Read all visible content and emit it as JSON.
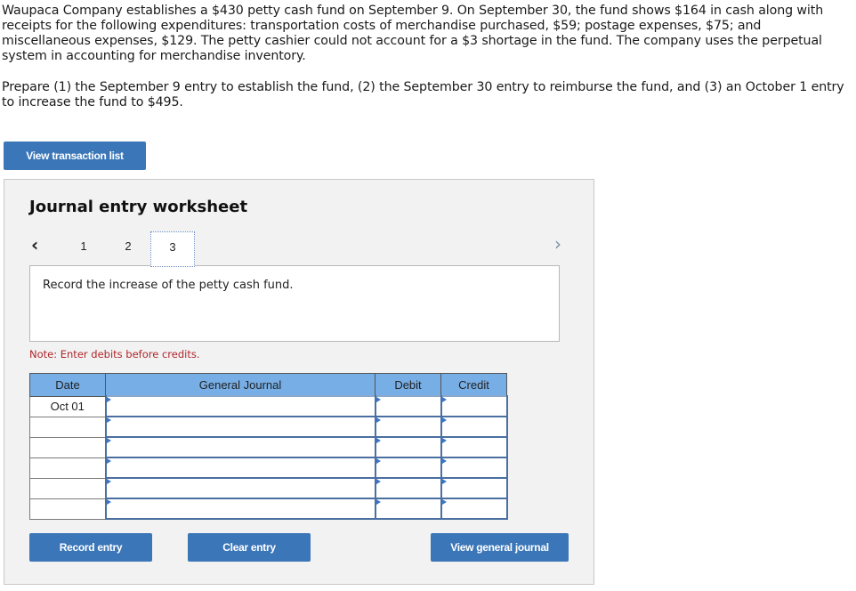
{
  "question": {
    "paragraph1": "Waupaca Company establishes a $430 petty cash fund on September 9. On September 30, the fund shows $164 in cash along with receipts for the following expenditures: transportation costs of merchandise purchased, $59; postage expenses, $75; and miscellaneous expenses, $129. The petty cashier could not account for a $3 shortage in the fund. The company uses the perpetual system in accounting for merchandise inventory.",
    "paragraph2": "Prepare (1) the September 9 entry to establish the fund, (2) the September 30 entry to reimburse the fund, and (3) an October 1 entry to increase the fund to $495."
  },
  "buttons": {
    "view_transaction_list": "View transaction list",
    "record_entry": "Record entry",
    "clear_entry": "Clear entry",
    "view_general_journal": "View general journal"
  },
  "worksheet": {
    "title": "Journal entry worksheet",
    "prev_icon": "‹",
    "next_icon": "›",
    "tabs": [
      {
        "label": "1",
        "active": false
      },
      {
        "label": "2",
        "active": false
      },
      {
        "label": "3",
        "active": true
      }
    ],
    "description": "Record the increase of the petty cash fund.",
    "note": "Note: Enter debits before credits."
  },
  "journal": {
    "headers": {
      "date": "Date",
      "general_journal": "General Journal",
      "debit": "Debit",
      "credit": "Credit"
    },
    "rows": [
      {
        "date": "Oct 01",
        "account": "",
        "debit": "",
        "credit": ""
      },
      {
        "date": "",
        "account": "",
        "debit": "",
        "credit": ""
      },
      {
        "date": "",
        "account": "",
        "debit": "",
        "credit": ""
      },
      {
        "date": "",
        "account": "",
        "debit": "",
        "credit": ""
      },
      {
        "date": "",
        "account": "",
        "debit": "",
        "credit": ""
      },
      {
        "date": "",
        "account": "",
        "debit": "",
        "credit": ""
      }
    ]
  },
  "colors": {
    "button_blue": "#3a76b8",
    "header_blue": "#77aee5",
    "note_red": "#b0262b",
    "panel_gray": "#f2f2f2"
  }
}
